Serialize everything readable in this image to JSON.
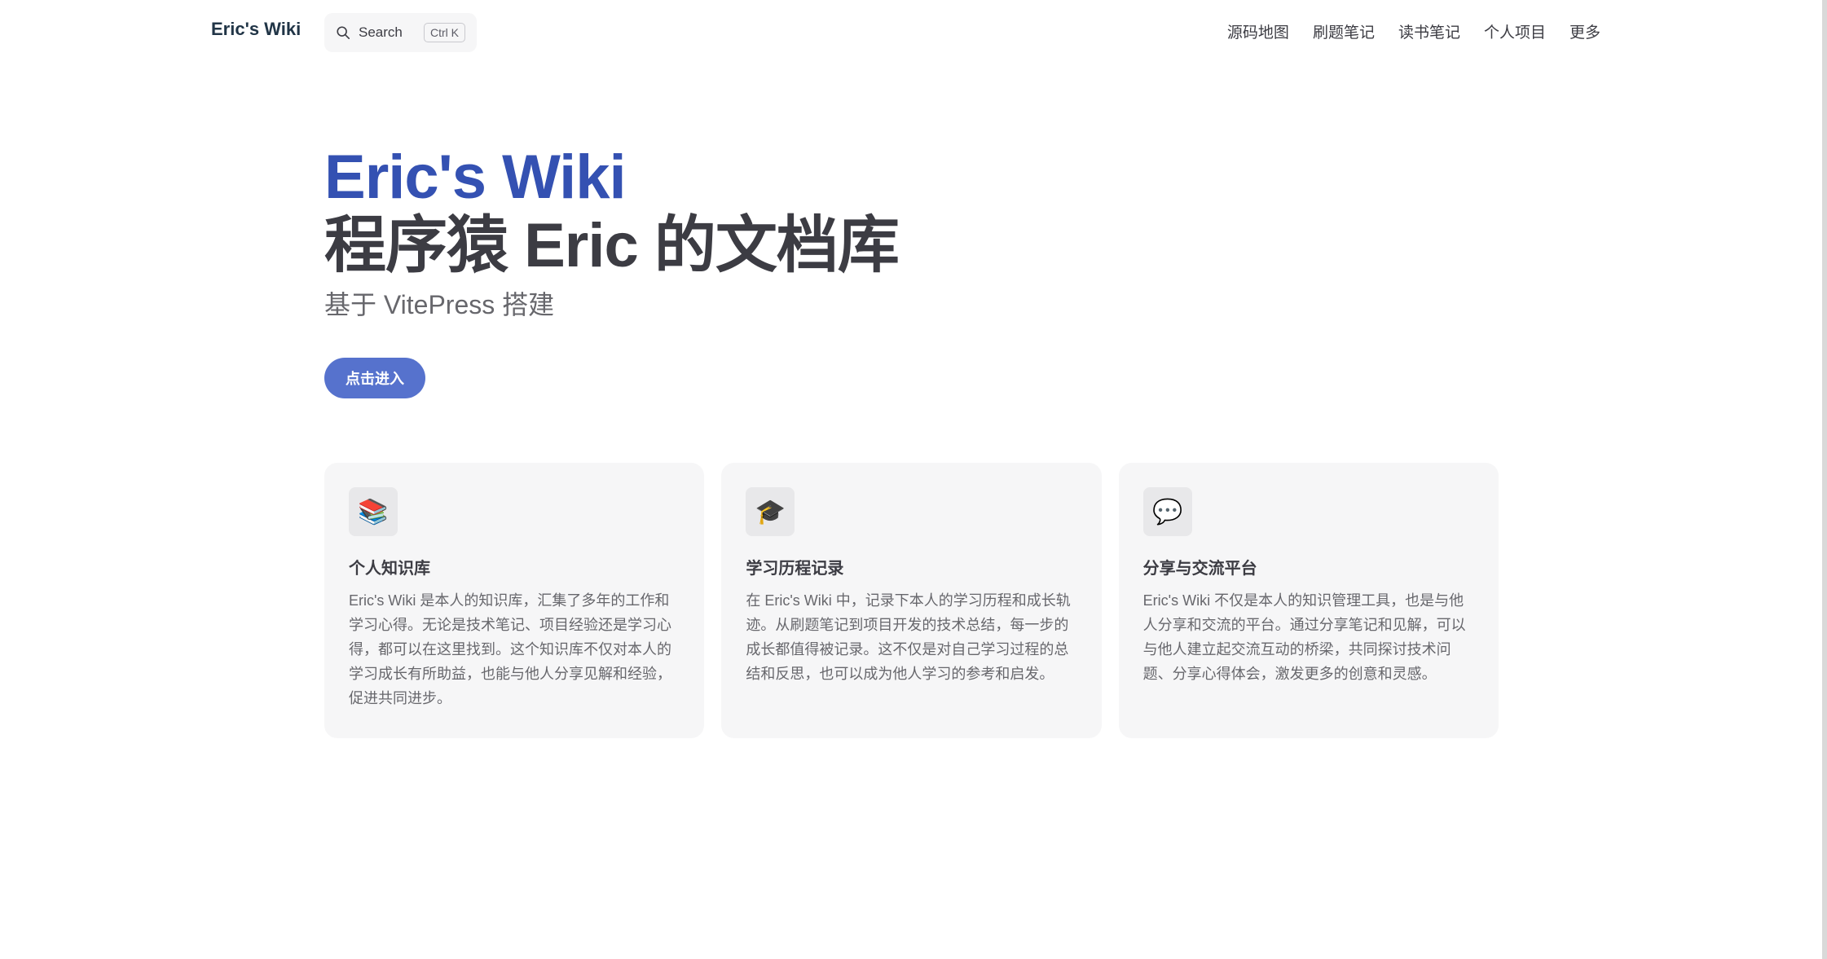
{
  "nav": {
    "title": "Eric's Wiki",
    "search": {
      "label": "Search",
      "shortcut": "Ctrl K",
      "icon": "search-icon"
    },
    "links": [
      {
        "label": "源码地图"
      },
      {
        "label": "刷题笔记"
      },
      {
        "label": "读书笔记"
      },
      {
        "label": "个人项目"
      },
      {
        "label": "更多"
      }
    ]
  },
  "hero": {
    "name": "Eric's Wiki",
    "text": "程序猿 Eric 的文档库",
    "tagline": "基于 VitePress 搭建",
    "action_label": "点击进入"
  },
  "features": [
    {
      "icon": "books-icon",
      "glyph": "📚",
      "title": "个人知识库",
      "details": "Eric's Wiki 是本人的知识库，汇集了多年的工作和学习心得。无论是技术笔记、项目经验还是学习心得，都可以在这里找到。这个知识库不仅对本人的学习成长有所助益，也能与他人分享见解和经验，促进共同进步。"
    },
    {
      "icon": "graduation-cap-icon",
      "glyph": "🎓",
      "title": "学习历程记录",
      "details": "在 Eric's Wiki 中，记录下本人的学习历程和成长轨迹。从刷题笔记到项目开发的技术总结，每一步的成长都值得被记录。这不仅是对自己学习过程的总结和反思，也可以成为他人学习的参考和启发。"
    },
    {
      "icon": "speech-bubble-icon",
      "glyph": "💬",
      "title": "分享与交流平台",
      "details": "Eric's Wiki 不仅是本人的知识管理工具，也是与他人分享和交流的平台。通过分享笔记和见解，可以与他人建立起交流互动的桥梁，共同探讨技术问题、分享心得体会，激发更多的创意和灵感。"
    }
  ],
  "colors": {
    "brand": "#3451b2",
    "button": "#5672cd",
    "card_bg": "#f6f6f7"
  }
}
